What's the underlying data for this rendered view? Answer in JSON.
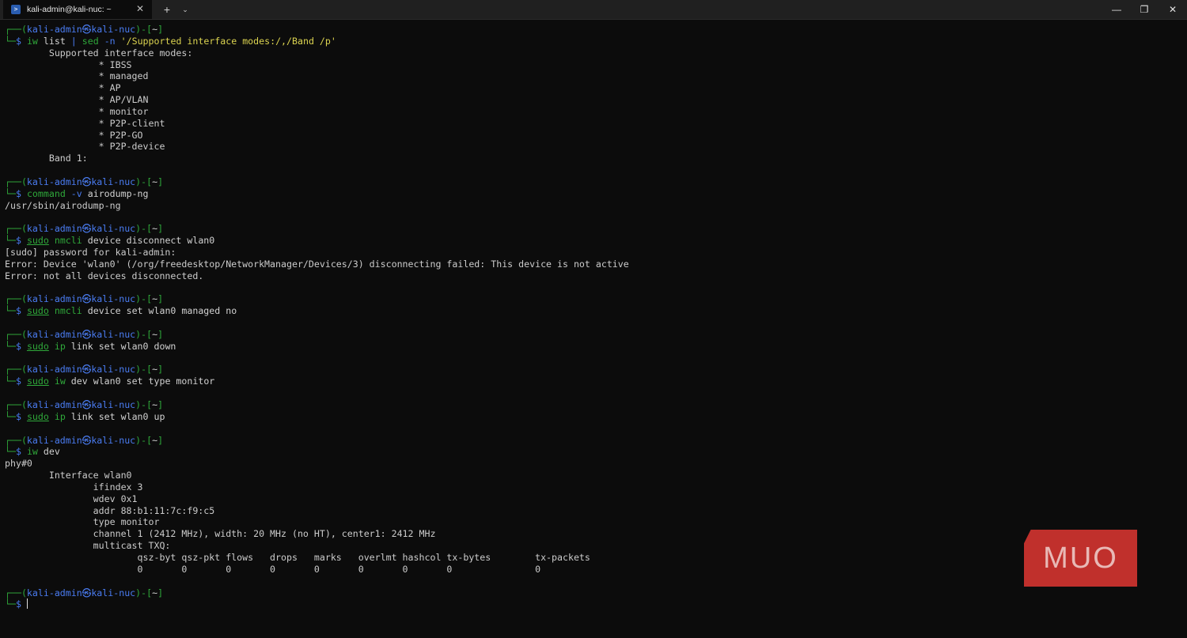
{
  "window": {
    "tab_title": "kali-admin@kali-nuc: ~",
    "tab_close": "✕",
    "new_tab": "+",
    "tab_menu": "⌄",
    "minimize": "—",
    "maximize": "❐",
    "close": "✕"
  },
  "prompt": {
    "open": "┌──(",
    "user_host": "kali-admin㉿kali-nuc",
    "mid": ")-[",
    "dir": "~",
    "close": "]",
    "second": "└─",
    "dollar": "$ "
  },
  "cmd": {
    "iw_list": {
      "p1": "iw",
      "p2": " list ",
      "p3": "|",
      "p4": " ",
      "p5": "sed",
      "p6": " -n ",
      "p7": "'/Supported interface modes:/,/Band /p'"
    },
    "command_v": {
      "p1": "command",
      "p2": " -v ",
      "p3": "airodump-ng"
    },
    "nmcli_disconnect": {
      "p1": "sudo",
      "p2": " ",
      "p3": "nmcli",
      "p4": " device disconnect wlan0"
    },
    "nmcli_managed": {
      "p1": "sudo",
      "p2": " ",
      "p3": "nmcli",
      "p4": " device set wlan0 managed no"
    },
    "ip_down": {
      "p1": "sudo",
      "p2": " ",
      "p3": "ip",
      "p4": " link set wlan0 down"
    },
    "iw_monitor": {
      "p1": "sudo",
      "p2": " ",
      "p3": "iw",
      "p4": " dev wlan0 set type monitor"
    },
    "ip_up": {
      "p1": "sudo",
      "p2": " ",
      "p3": "ip",
      "p4": " link set wlan0 up"
    },
    "iw_dev": {
      "p1": "iw",
      "p2": " dev"
    }
  },
  "output": {
    "modes_header": "        Supported interface modes:",
    "modes": [
      "                 * IBSS",
      "                 * managed",
      "                 * AP",
      "                 * AP/VLAN",
      "                 * monitor",
      "                 * P2P-client",
      "                 * P2P-GO",
      "                 * P2P-device"
    ],
    "band": "        Band 1:",
    "airodump_path": "/usr/sbin/airodump-ng",
    "sudo_prompt": "[sudo] password for kali-admin:",
    "error1": "Error: Device 'wlan0' (/org/freedesktop/NetworkManager/Devices/3) disconnecting failed: This device is not active",
    "error2": "Error: not all devices disconnected.",
    "iwdev": [
      "phy#0",
      "        Interface wlan0",
      "                ifindex 3",
      "                wdev 0x1",
      "                addr 88:b1:11:7c:f9:c5",
      "                type monitor",
      "                channel 1 (2412 MHz), width: 20 MHz (no HT), center1: 2412 MHz",
      "                multicast TXQ:",
      "                        qsz-byt qsz-pkt flows   drops   marks   overlmt hashcol tx-bytes        tx-packets",
      "                        0       0       0       0       0       0       0       0               0"
    ]
  },
  "logo": "MUO",
  "colors": {
    "background": "#0c0c0c",
    "prompt_green": "#2fa83a",
    "prompt_blue": "#4a7cf2",
    "string_yellow": "#dcd450",
    "logo_red": "#c0302c"
  }
}
